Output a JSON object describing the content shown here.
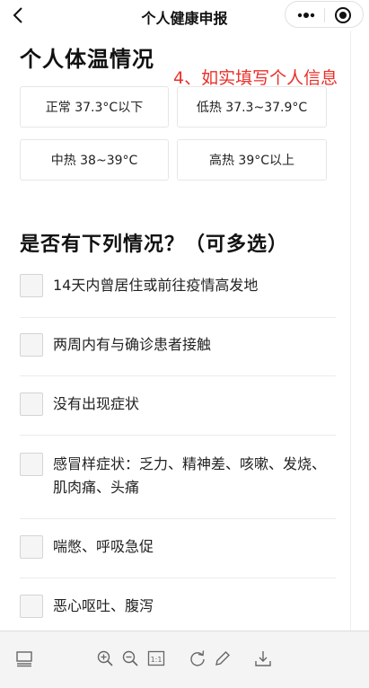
{
  "nav": {
    "back_icon": "chevron-left-icon",
    "title": "个人健康申报",
    "more_icon": "more-dots-icon",
    "close_icon": "target-circle-icon"
  },
  "form": {
    "section1_title": "个人体温情况",
    "annotation": "4、如实填写个人信息",
    "annotation_color": "#e8302a",
    "temperature_options": [
      "正常 37.3°C以下",
      "低热 37.3~37.9°C",
      "中热 38~39°C",
      "高热 39°C以上"
    ],
    "section2_title": "是否有下列情况？（可多选）",
    "conditions": [
      "14天内曾居住或前往疫情高发地",
      "两周内有与确诊患者接触",
      "没有出现症状",
      "感冒样症状：乏力、精神差、咳嗽、发烧、肌肉痛、头痛",
      "喘憋、呼吸急促",
      "恶心呕吐、腹泻"
    ]
  },
  "toolbar": {
    "icons": [
      "sidebar-toggle-icon",
      "zoom-in-icon",
      "zoom-out-icon",
      "actual-size-icon",
      "rotate-icon",
      "pen-icon",
      "download-icon"
    ],
    "actual_size_label": "1:1"
  }
}
